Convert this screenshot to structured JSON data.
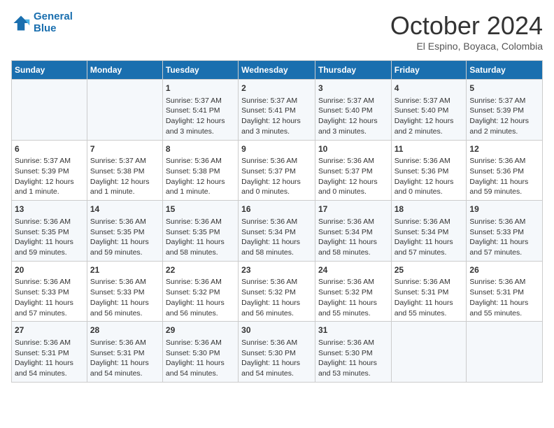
{
  "header": {
    "logo_line1": "General",
    "logo_line2": "Blue",
    "month": "October 2024",
    "location": "El Espino, Boyaca, Colombia"
  },
  "days_of_week": [
    "Sunday",
    "Monday",
    "Tuesday",
    "Wednesday",
    "Thursday",
    "Friday",
    "Saturday"
  ],
  "weeks": [
    [
      {
        "day": "",
        "info": ""
      },
      {
        "day": "",
        "info": ""
      },
      {
        "day": "1",
        "info": "Sunrise: 5:37 AM\nSunset: 5:41 PM\nDaylight: 12 hours and 3 minutes."
      },
      {
        "day": "2",
        "info": "Sunrise: 5:37 AM\nSunset: 5:41 PM\nDaylight: 12 hours and 3 minutes."
      },
      {
        "day": "3",
        "info": "Sunrise: 5:37 AM\nSunset: 5:40 PM\nDaylight: 12 hours and 3 minutes."
      },
      {
        "day": "4",
        "info": "Sunrise: 5:37 AM\nSunset: 5:40 PM\nDaylight: 12 hours and 2 minutes."
      },
      {
        "day": "5",
        "info": "Sunrise: 5:37 AM\nSunset: 5:39 PM\nDaylight: 12 hours and 2 minutes."
      }
    ],
    [
      {
        "day": "6",
        "info": "Sunrise: 5:37 AM\nSunset: 5:39 PM\nDaylight: 12 hours and 1 minute."
      },
      {
        "day": "7",
        "info": "Sunrise: 5:37 AM\nSunset: 5:38 PM\nDaylight: 12 hours and 1 minute."
      },
      {
        "day": "8",
        "info": "Sunrise: 5:36 AM\nSunset: 5:38 PM\nDaylight: 12 hours and 1 minute."
      },
      {
        "day": "9",
        "info": "Sunrise: 5:36 AM\nSunset: 5:37 PM\nDaylight: 12 hours and 0 minutes."
      },
      {
        "day": "10",
        "info": "Sunrise: 5:36 AM\nSunset: 5:37 PM\nDaylight: 12 hours and 0 minutes."
      },
      {
        "day": "11",
        "info": "Sunrise: 5:36 AM\nSunset: 5:36 PM\nDaylight: 12 hours and 0 minutes."
      },
      {
        "day": "12",
        "info": "Sunrise: 5:36 AM\nSunset: 5:36 PM\nDaylight: 11 hours and 59 minutes."
      }
    ],
    [
      {
        "day": "13",
        "info": "Sunrise: 5:36 AM\nSunset: 5:35 PM\nDaylight: 11 hours and 59 minutes."
      },
      {
        "day": "14",
        "info": "Sunrise: 5:36 AM\nSunset: 5:35 PM\nDaylight: 11 hours and 59 minutes."
      },
      {
        "day": "15",
        "info": "Sunrise: 5:36 AM\nSunset: 5:35 PM\nDaylight: 11 hours and 58 minutes."
      },
      {
        "day": "16",
        "info": "Sunrise: 5:36 AM\nSunset: 5:34 PM\nDaylight: 11 hours and 58 minutes."
      },
      {
        "day": "17",
        "info": "Sunrise: 5:36 AM\nSunset: 5:34 PM\nDaylight: 11 hours and 58 minutes."
      },
      {
        "day": "18",
        "info": "Sunrise: 5:36 AM\nSunset: 5:34 PM\nDaylight: 11 hours and 57 minutes."
      },
      {
        "day": "19",
        "info": "Sunrise: 5:36 AM\nSunset: 5:33 PM\nDaylight: 11 hours and 57 minutes."
      }
    ],
    [
      {
        "day": "20",
        "info": "Sunrise: 5:36 AM\nSunset: 5:33 PM\nDaylight: 11 hours and 57 minutes."
      },
      {
        "day": "21",
        "info": "Sunrise: 5:36 AM\nSunset: 5:33 PM\nDaylight: 11 hours and 56 minutes."
      },
      {
        "day": "22",
        "info": "Sunrise: 5:36 AM\nSunset: 5:32 PM\nDaylight: 11 hours and 56 minutes."
      },
      {
        "day": "23",
        "info": "Sunrise: 5:36 AM\nSunset: 5:32 PM\nDaylight: 11 hours and 56 minutes."
      },
      {
        "day": "24",
        "info": "Sunrise: 5:36 AM\nSunset: 5:32 PM\nDaylight: 11 hours and 55 minutes."
      },
      {
        "day": "25",
        "info": "Sunrise: 5:36 AM\nSunset: 5:31 PM\nDaylight: 11 hours and 55 minutes."
      },
      {
        "day": "26",
        "info": "Sunrise: 5:36 AM\nSunset: 5:31 PM\nDaylight: 11 hours and 55 minutes."
      }
    ],
    [
      {
        "day": "27",
        "info": "Sunrise: 5:36 AM\nSunset: 5:31 PM\nDaylight: 11 hours and 54 minutes."
      },
      {
        "day": "28",
        "info": "Sunrise: 5:36 AM\nSunset: 5:31 PM\nDaylight: 11 hours and 54 minutes."
      },
      {
        "day": "29",
        "info": "Sunrise: 5:36 AM\nSunset: 5:30 PM\nDaylight: 11 hours and 54 minutes."
      },
      {
        "day": "30",
        "info": "Sunrise: 5:36 AM\nSunset: 5:30 PM\nDaylight: 11 hours and 54 minutes."
      },
      {
        "day": "31",
        "info": "Sunrise: 5:36 AM\nSunset: 5:30 PM\nDaylight: 11 hours and 53 minutes."
      },
      {
        "day": "",
        "info": ""
      },
      {
        "day": "",
        "info": ""
      }
    ]
  ]
}
